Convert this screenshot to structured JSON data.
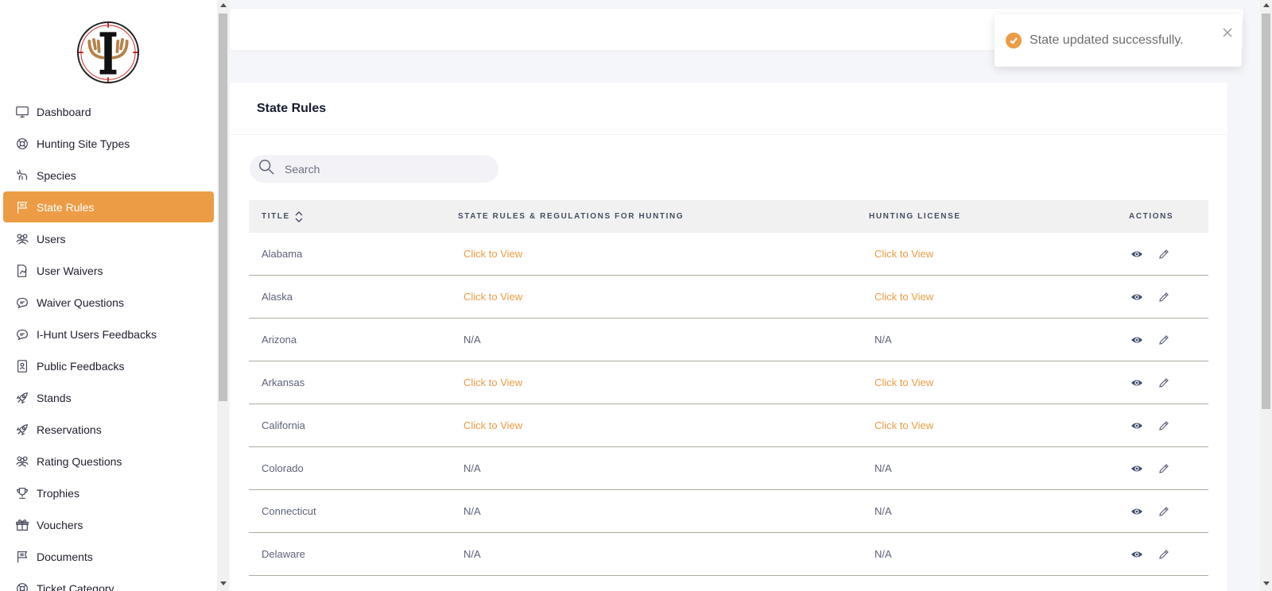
{
  "sidebar": {
    "logo_alt": "I-Hunt logo",
    "items": [
      {
        "label": "Dashboard",
        "icon": "monitor-icon"
      },
      {
        "label": "Hunting Site Types",
        "icon": "lifebuoy-icon"
      },
      {
        "label": "Species",
        "icon": "deer-icon"
      },
      {
        "label": "State Rules",
        "icon": "flag-icon",
        "active": true
      },
      {
        "label": "Users",
        "icon": "users-icon"
      },
      {
        "label": "User Waivers",
        "icon": "document-edit-icon"
      },
      {
        "label": "Waiver Questions",
        "icon": "chat-bubble-icon"
      },
      {
        "label": "I-Hunt Users Feedbacks",
        "icon": "chat-bubble-icon"
      },
      {
        "label": "Public Feedbacks",
        "icon": "contact-book-icon"
      },
      {
        "label": "Stands",
        "icon": "rocket-icon"
      },
      {
        "label": "Reservations",
        "icon": "rocket-icon"
      },
      {
        "label": "Rating Questions",
        "icon": "users-icon"
      },
      {
        "label": "Trophies",
        "icon": "trophy-icon"
      },
      {
        "label": "Vouchers",
        "icon": "gift-icon"
      },
      {
        "label": "Documents",
        "icon": "flag-icon"
      },
      {
        "label": "Ticket Category",
        "icon": "lifebuoy-icon"
      }
    ]
  },
  "card": {
    "title": "State Rules"
  },
  "search": {
    "placeholder": "Search",
    "value": ""
  },
  "table": {
    "headers": {
      "title": "TITLE",
      "rules": "STATE RULES & REGULATIONS FOR HUNTING",
      "license": "HUNTING LICENSE",
      "actions": "ACTIONS"
    },
    "rows": [
      {
        "title": "Alabama",
        "rules": "Click to View",
        "rules_link": true,
        "license": "Click to View",
        "license_link": true
      },
      {
        "title": "Alaska",
        "rules": "Click to View",
        "rules_link": true,
        "license": "Click to View",
        "license_link": true
      },
      {
        "title": "Arizona",
        "rules": "N/A",
        "rules_link": false,
        "license": "N/A",
        "license_link": false
      },
      {
        "title": "Arkansas",
        "rules": "Click to View",
        "rules_link": true,
        "license": "Click to View",
        "license_link": true
      },
      {
        "title": "California",
        "rules": "Click to View",
        "rules_link": true,
        "license": "Click to View",
        "license_link": true
      },
      {
        "title": "Colorado",
        "rules": "N/A",
        "rules_link": false,
        "license": "N/A",
        "license_link": false
      },
      {
        "title": "Connecticut",
        "rules": "N/A",
        "rules_link": false,
        "license": "N/A",
        "license_link": false
      },
      {
        "title": "Delaware",
        "rules": "N/A",
        "rules_link": false,
        "license": "N/A",
        "license_link": false
      }
    ]
  },
  "toast": {
    "message": "State updated successfully.",
    "icon": "check-circle-icon"
  },
  "colors": {
    "accent": "#ec9c45",
    "title": "#181c32",
    "text": "#5e6278"
  }
}
